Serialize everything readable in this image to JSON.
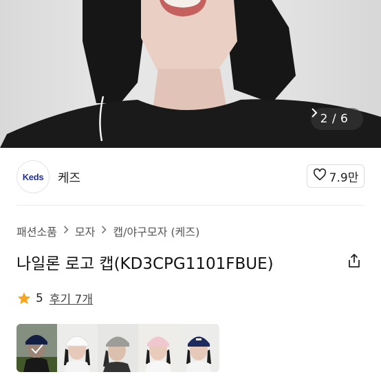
{
  "gallery": {
    "page_indicator": "2 / 6",
    "next_icon": "chevron-right-icon"
  },
  "brand": {
    "logo_text": "Keds",
    "name": "케즈",
    "likes": "7.9만",
    "like_icon": "heart-outline-icon"
  },
  "breadcrumb": {
    "items": [
      "패션소품",
      "모자",
      "캡/야구모자 (케즈)"
    ],
    "separator_icon": "chevron-right-icon"
  },
  "product": {
    "title": "나일론 로고 캡(KD3CPG1101FBUE)",
    "share_icon": "share-icon"
  },
  "rating": {
    "star_icon": "star-icon",
    "score": "5",
    "reviews": "후기 7개",
    "star_color": "#F5A623"
  },
  "thumbnails": {
    "items": [
      {
        "color": "navy",
        "selected": true
      },
      {
        "color": "white",
        "selected": false
      },
      {
        "color": "gray",
        "selected": false
      },
      {
        "color": "pink",
        "selected": false
      },
      {
        "color": "navy",
        "selected": false
      }
    ]
  },
  "colors": {
    "brand_logo": "#21319C",
    "overlay": "#3C3C3C"
  }
}
